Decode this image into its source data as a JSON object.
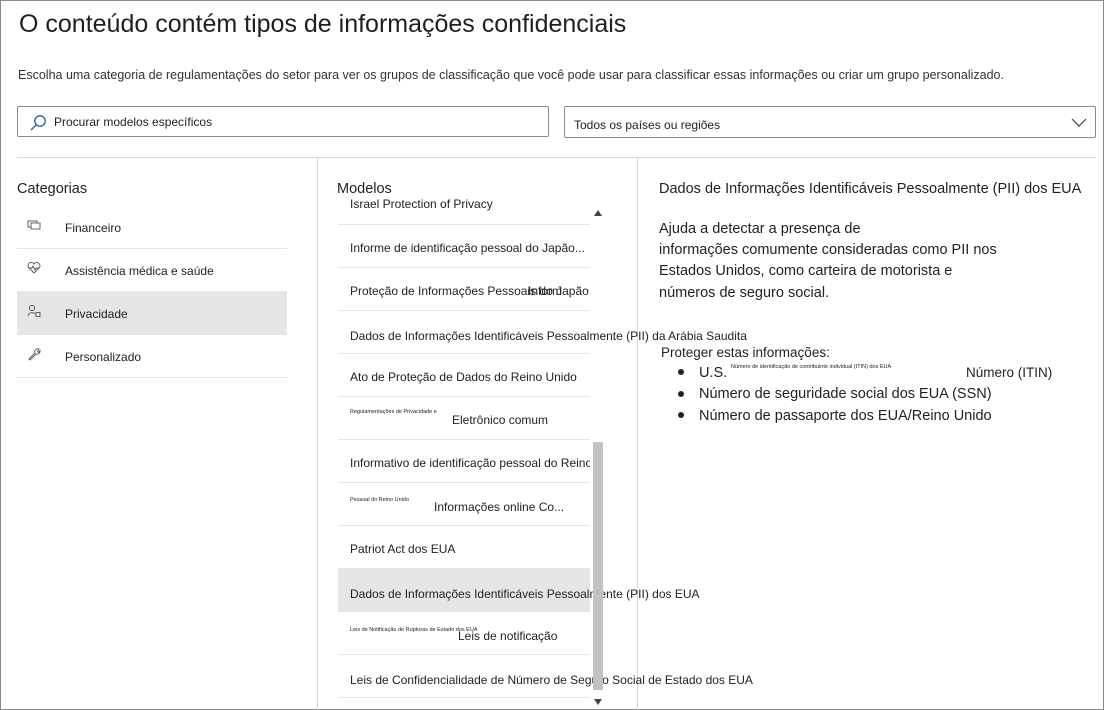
{
  "header": {
    "title": "O conteúdo contém tipos de informações confidenciais",
    "description": "Escolha uma categoria de regulamentações do setor para ver os grupos de classificação que você pode usar para classificar essas informações ou criar um grupo personalizado."
  },
  "search": {
    "placeholder": "Procurar modelos específicos",
    "icon": "search-icon"
  },
  "region_select": {
    "value": "Todos os países ou regiões",
    "icon": "chevron-down-icon"
  },
  "categories": {
    "heading": "Categorias",
    "items": [
      {
        "label": "Financeiro",
        "icon": "money-icon"
      },
      {
        "label": "Assistência médica e saúde",
        "icon": "heart-pulse-icon"
      },
      {
        "label": "Privacidade",
        "icon": "person-lock-icon",
        "selected": true
      },
      {
        "label": "Personalizado",
        "icon": "wrench-icon"
      }
    ]
  },
  "models": {
    "heading": "Modelos",
    "partial_top": "Israel Protection of Privacy",
    "items": [
      {
        "label": "Informe de identificação pessoal do Japão..."
      },
      {
        "label": "Proteção de Informações Pessoais do Japão",
        "overlay": "Inform"
      },
      {
        "label": "Dados de Informações Identificáveis Pessoalmente (PII) da Arábia Saudita"
      },
      {
        "label": "Ato de Proteção de Dados do Reino Unido"
      },
      {
        "tiny": "Regulamentações de Privacidade e",
        "label": "Eletrônico comum"
      },
      {
        "label": "Informativo de identificação pessoal do Reino Unido"
      },
      {
        "tiny": "Pessoal do Reino Unido",
        "label": "Informações online Co..."
      },
      {
        "label": "Patriot Act dos EUA"
      },
      {
        "label": "Dados de Informações Identificáveis Pessoalmente (PII) dos EUA",
        "selected": true
      },
      {
        "tiny": "Leis de Notificação de Rupturas de Estado dos EUA",
        "label": "Leis de notificação"
      },
      {
        "label": "Leis de Confidencialidade de Número de Seguro Social de Estado dos EUA"
      }
    ]
  },
  "detail": {
    "title": "Dados de Informações Identificáveis Pessoalmente (PII) dos EUA",
    "description_lines": [
      "Ajuda a detectar a presença de",
      "informações comumente consideradas como PII nos",
      "Estados Unidos, como carteira de motorista e",
      "números de seguro social."
    ],
    "protect_label": "Proteger estas informações:",
    "info_types": [
      {
        "prefix": "U.S.",
        "tiny": "Número de identificação de contribuinte individual (ITIN) dos EUA",
        "suffix": "Número (ITIN)"
      },
      {
        "label": "Número de seguridade social dos EUA (SSN)"
      },
      {
        "label": "Número de passaporte dos EUA/Reino Unido"
      }
    ]
  }
}
